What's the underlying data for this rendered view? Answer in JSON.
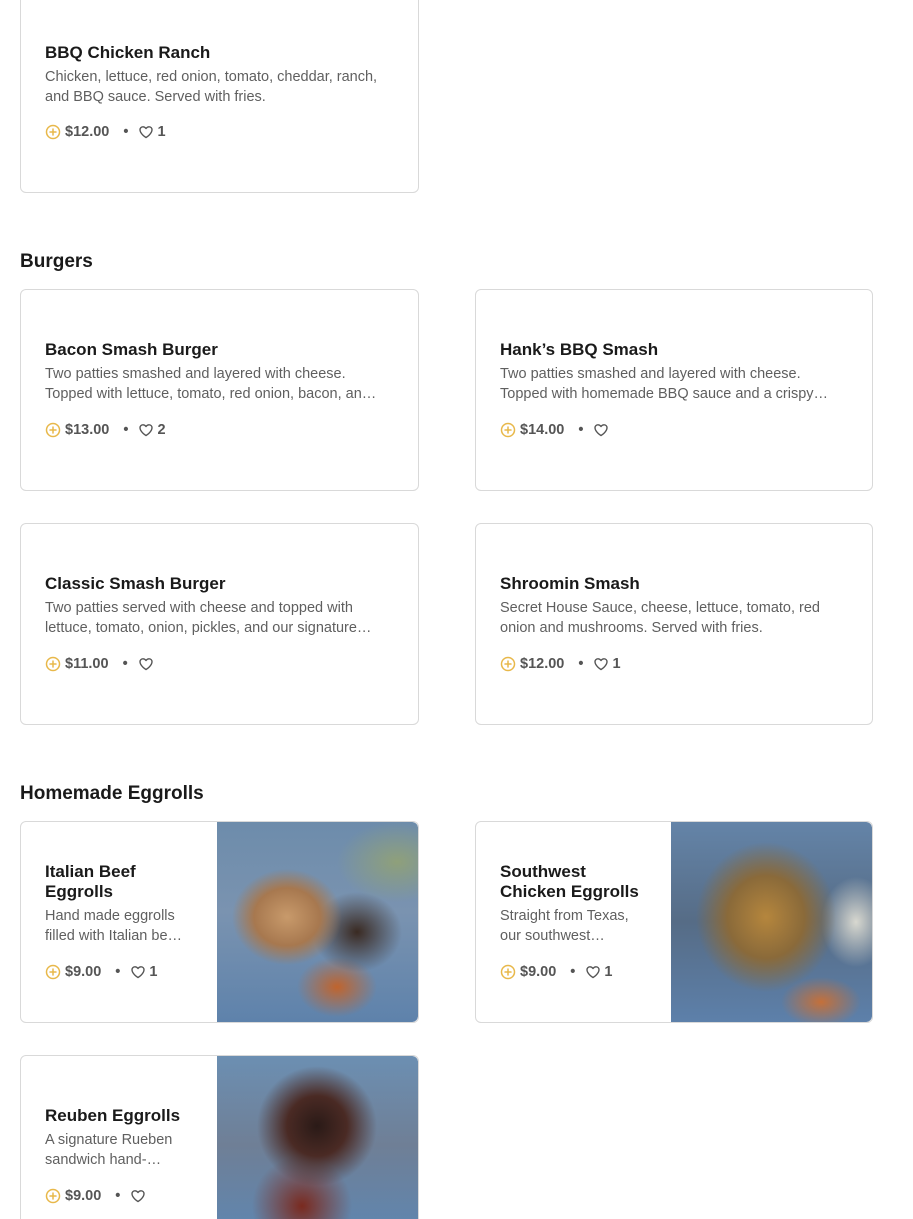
{
  "sections": {
    "burgers": "Burgers",
    "eggrolls": "Homemade Eggrolls"
  },
  "items": {
    "bbq_chicken_ranch": {
      "title": "BBQ Chicken Ranch",
      "desc": "Chicken, lettuce, red onion, tomato, cheddar, ranch, and BBQ sauce. Served with fries.",
      "price": "$12.00",
      "likes": "1"
    },
    "bacon_smash": {
      "title": "Bacon Smash Burger",
      "desc": "Two patties smashed and layered with cheese. Topped with lettuce, tomato, red onion, bacon, an…",
      "price": "$13.00",
      "likes": "2"
    },
    "hanks_bbq": {
      "title": "Hank’s BBQ Smash",
      "desc": "Two patties smashed and layered with cheese. Topped with homemade BBQ sauce and a crispy…",
      "price": "$14.00",
      "likes": ""
    },
    "classic_smash": {
      "title": "Classic Smash Burger",
      "desc": "Two patties served with cheese and topped with lettuce, tomato, onion, pickles, and our signature…",
      "price": "$11.00",
      "likes": ""
    },
    "shroomin": {
      "title": "Shroomin Smash",
      "desc": "Secret House Sauce, cheese, lettuce, tomato, red onion and mushrooms. Served with fries.",
      "price": "$12.00",
      "likes": "1"
    },
    "italian_beef": {
      "title": "Italian Beef Eggrolls",
      "desc": "Hand made eggrolls filled with Italian be…",
      "price": "$9.00",
      "likes": "1"
    },
    "southwest": {
      "title": "Southwest Chicken Eggrolls",
      "desc": "Straight from Texas, our southwest…",
      "price": "$9.00",
      "likes": "1"
    },
    "reuben": {
      "title": "Reuben Eggrolls",
      "desc": "A signature Rueben sandwich hand-…",
      "price": "$9.00",
      "likes": ""
    }
  },
  "meta": {
    "separator": "•"
  },
  "colors": {
    "price_icon": "#e8b84a",
    "heart_stroke": "#555555",
    "border": "#d9d9d9"
  },
  "icons": {
    "price": "plus-circle-icon",
    "like": "heart-outline-icon"
  }
}
